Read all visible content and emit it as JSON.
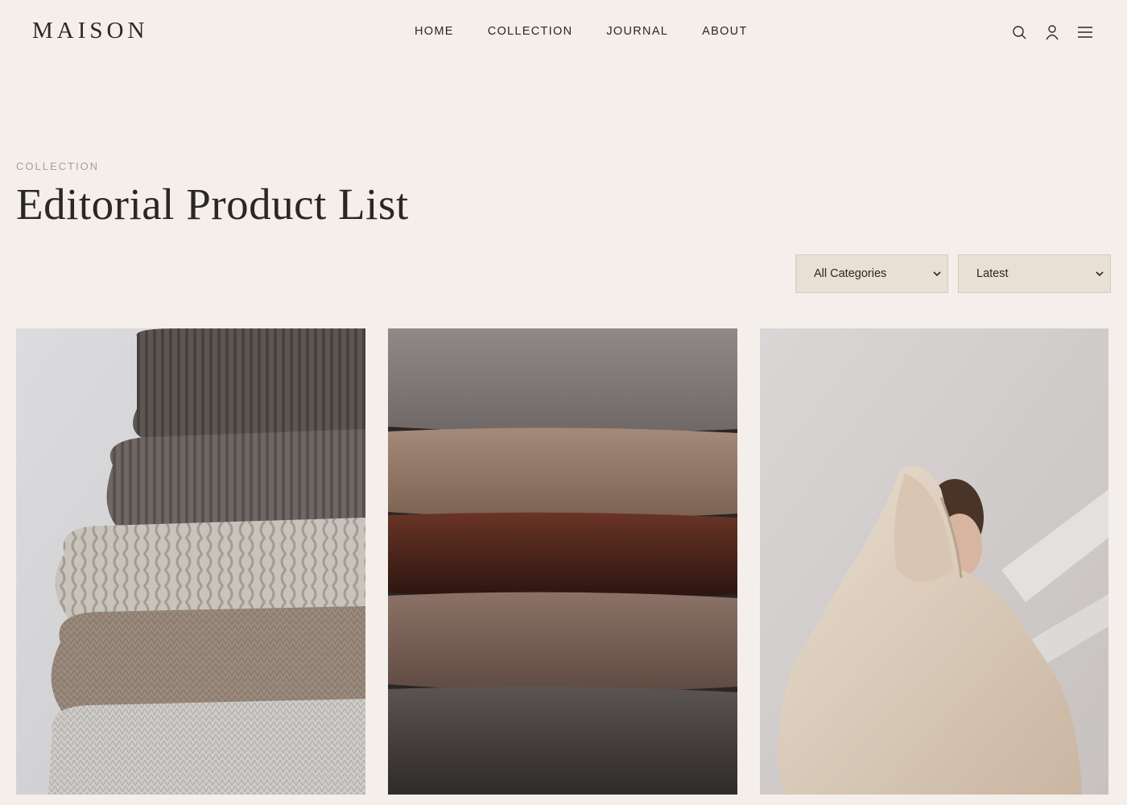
{
  "brand": {
    "logo": "MAISON"
  },
  "nav": {
    "items": [
      "HOME",
      "COLLECTION",
      "JOURNAL",
      "ABOUT"
    ]
  },
  "header_icons": [
    "search-icon",
    "user-icon",
    "menu-icon"
  ],
  "page": {
    "eyebrow": "COLLECTION",
    "title": "Editorial Product List"
  },
  "filters": {
    "category": "All Categories",
    "sort": "Latest"
  },
  "colors": {
    "background": "#f4efea",
    "select_bg": "#e8dfd5",
    "eyebrow": "#a89f94",
    "text": "#2b2724"
  }
}
